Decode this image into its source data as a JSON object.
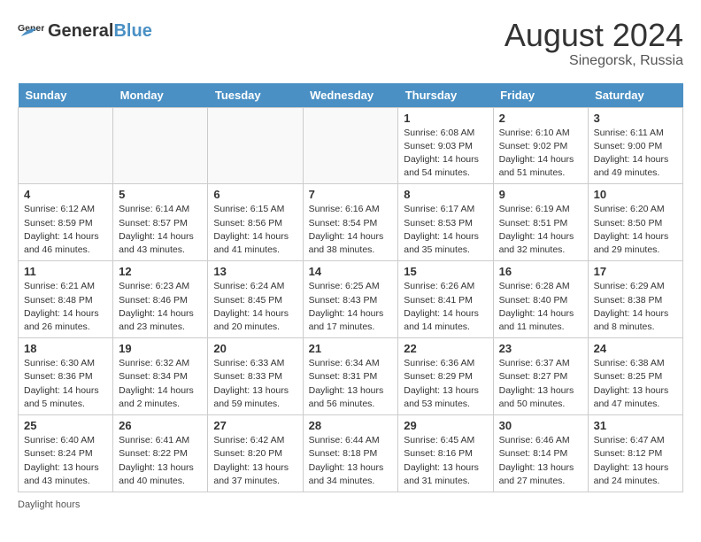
{
  "header": {
    "logo_general": "General",
    "logo_blue": "Blue",
    "month_year": "August 2024",
    "location": "Sinegorsk, Russia"
  },
  "footer": {
    "note": "Daylight hours"
  },
  "days_of_week": [
    "Sunday",
    "Monday",
    "Tuesday",
    "Wednesday",
    "Thursday",
    "Friday",
    "Saturday"
  ],
  "weeks": [
    [
      {
        "day": "",
        "info": ""
      },
      {
        "day": "",
        "info": ""
      },
      {
        "day": "",
        "info": ""
      },
      {
        "day": "",
        "info": ""
      },
      {
        "day": "1",
        "info": "Sunrise: 6:08 AM\nSunset: 9:03 PM\nDaylight: 14 hours\nand 54 minutes."
      },
      {
        "day": "2",
        "info": "Sunrise: 6:10 AM\nSunset: 9:02 PM\nDaylight: 14 hours\nand 51 minutes."
      },
      {
        "day": "3",
        "info": "Sunrise: 6:11 AM\nSunset: 9:00 PM\nDaylight: 14 hours\nand 49 minutes."
      }
    ],
    [
      {
        "day": "4",
        "info": "Sunrise: 6:12 AM\nSunset: 8:59 PM\nDaylight: 14 hours\nand 46 minutes."
      },
      {
        "day": "5",
        "info": "Sunrise: 6:14 AM\nSunset: 8:57 PM\nDaylight: 14 hours\nand 43 minutes."
      },
      {
        "day": "6",
        "info": "Sunrise: 6:15 AM\nSunset: 8:56 PM\nDaylight: 14 hours\nand 41 minutes."
      },
      {
        "day": "7",
        "info": "Sunrise: 6:16 AM\nSunset: 8:54 PM\nDaylight: 14 hours\nand 38 minutes."
      },
      {
        "day": "8",
        "info": "Sunrise: 6:17 AM\nSunset: 8:53 PM\nDaylight: 14 hours\nand 35 minutes."
      },
      {
        "day": "9",
        "info": "Sunrise: 6:19 AM\nSunset: 8:51 PM\nDaylight: 14 hours\nand 32 minutes."
      },
      {
        "day": "10",
        "info": "Sunrise: 6:20 AM\nSunset: 8:50 PM\nDaylight: 14 hours\nand 29 minutes."
      }
    ],
    [
      {
        "day": "11",
        "info": "Sunrise: 6:21 AM\nSunset: 8:48 PM\nDaylight: 14 hours\nand 26 minutes."
      },
      {
        "day": "12",
        "info": "Sunrise: 6:23 AM\nSunset: 8:46 PM\nDaylight: 14 hours\nand 23 minutes."
      },
      {
        "day": "13",
        "info": "Sunrise: 6:24 AM\nSunset: 8:45 PM\nDaylight: 14 hours\nand 20 minutes."
      },
      {
        "day": "14",
        "info": "Sunrise: 6:25 AM\nSunset: 8:43 PM\nDaylight: 14 hours\nand 17 minutes."
      },
      {
        "day": "15",
        "info": "Sunrise: 6:26 AM\nSunset: 8:41 PM\nDaylight: 14 hours\nand 14 minutes."
      },
      {
        "day": "16",
        "info": "Sunrise: 6:28 AM\nSunset: 8:40 PM\nDaylight: 14 hours\nand 11 minutes."
      },
      {
        "day": "17",
        "info": "Sunrise: 6:29 AM\nSunset: 8:38 PM\nDaylight: 14 hours\nand 8 minutes."
      }
    ],
    [
      {
        "day": "18",
        "info": "Sunrise: 6:30 AM\nSunset: 8:36 PM\nDaylight: 14 hours\nand 5 minutes."
      },
      {
        "day": "19",
        "info": "Sunrise: 6:32 AM\nSunset: 8:34 PM\nDaylight: 14 hours\nand 2 minutes."
      },
      {
        "day": "20",
        "info": "Sunrise: 6:33 AM\nSunset: 8:33 PM\nDaylight: 13 hours\nand 59 minutes."
      },
      {
        "day": "21",
        "info": "Sunrise: 6:34 AM\nSunset: 8:31 PM\nDaylight: 13 hours\nand 56 minutes."
      },
      {
        "day": "22",
        "info": "Sunrise: 6:36 AM\nSunset: 8:29 PM\nDaylight: 13 hours\nand 53 minutes."
      },
      {
        "day": "23",
        "info": "Sunrise: 6:37 AM\nSunset: 8:27 PM\nDaylight: 13 hours\nand 50 minutes."
      },
      {
        "day": "24",
        "info": "Sunrise: 6:38 AM\nSunset: 8:25 PM\nDaylight: 13 hours\nand 47 minutes."
      }
    ],
    [
      {
        "day": "25",
        "info": "Sunrise: 6:40 AM\nSunset: 8:24 PM\nDaylight: 13 hours\nand 43 minutes."
      },
      {
        "day": "26",
        "info": "Sunrise: 6:41 AM\nSunset: 8:22 PM\nDaylight: 13 hours\nand 40 minutes."
      },
      {
        "day": "27",
        "info": "Sunrise: 6:42 AM\nSunset: 8:20 PM\nDaylight: 13 hours\nand 37 minutes."
      },
      {
        "day": "28",
        "info": "Sunrise: 6:44 AM\nSunset: 8:18 PM\nDaylight: 13 hours\nand 34 minutes."
      },
      {
        "day": "29",
        "info": "Sunrise: 6:45 AM\nSunset: 8:16 PM\nDaylight: 13 hours\nand 31 minutes."
      },
      {
        "day": "30",
        "info": "Sunrise: 6:46 AM\nSunset: 8:14 PM\nDaylight: 13 hours\nand 27 minutes."
      },
      {
        "day": "31",
        "info": "Sunrise: 6:47 AM\nSunset: 8:12 PM\nDaylight: 13 hours\nand 24 minutes."
      }
    ]
  ]
}
